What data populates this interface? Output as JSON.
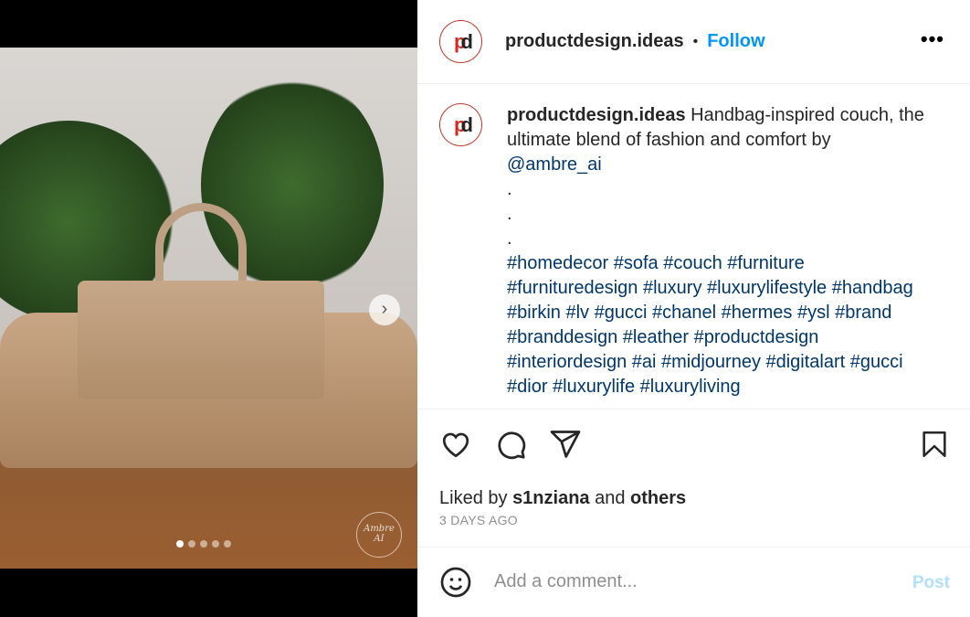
{
  "post": {
    "username": "productdesign.ideas",
    "avatar_text": {
      "p": "p",
      "d": "d"
    },
    "follow_label": "Follow",
    "separator": "•",
    "more_label": "•••",
    "caption": {
      "text": "Handbag-inspired couch, the ultimate blend of fashion and comfort by",
      "mention": "@ambre_ai",
      "dots": [
        ".",
        ".",
        "."
      ],
      "hashtags": "#homedecor #sofa #couch #furniture #furnituredesign #luxury #luxurylifestyle #handbag #birkin #lv #gucci #chanel #hermes #ysl #brand #branddesign #leather #productdesign #interiordesign #ai #midjourney #digitalart #gucci #dior #luxurylife #luxuryliving"
    },
    "liked_by_prefix": "Liked by",
    "liked_by_user": "s1nziana",
    "liked_by_and": "and",
    "liked_by_others": "others",
    "time_ago": "3 DAYS AGO",
    "comment_placeholder": "Add a comment...",
    "post_label": "Post",
    "carousel": {
      "count": 5,
      "active": 1,
      "next_label": "›"
    },
    "watermark": "Ambre AI",
    "colors": {
      "follow": "#0095f6",
      "link": "#00376b",
      "post_disabled": "#b2dffc"
    }
  }
}
